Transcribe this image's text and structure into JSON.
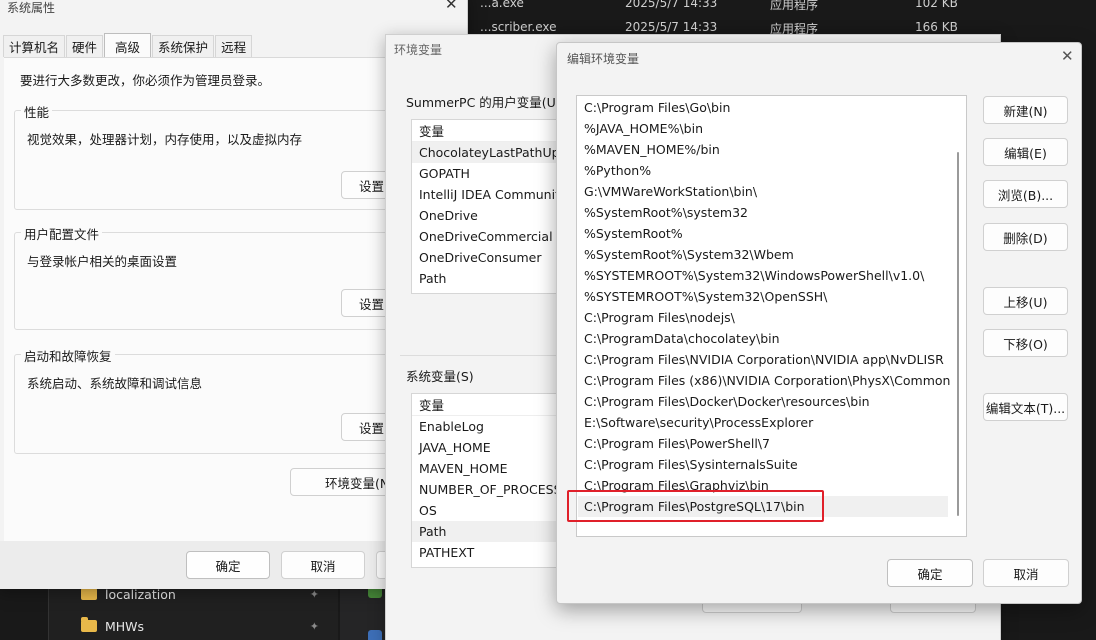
{
  "explorer": {
    "rows": [
      {
        "name": "...a.exe",
        "date": "2025/5/7 14:33",
        "type": "应用程序",
        "size": "102 KB"
      },
      {
        "name": "...scriber.exe",
        "date": "2025/5/7 14:33",
        "type": "应用程序",
        "size": "166 KB"
      }
    ],
    "sidebar": [
      {
        "label": "localization"
      },
      {
        "label": "MHWs"
      }
    ]
  },
  "system_properties": {
    "title": "系统属性",
    "tabs": [
      "计算机名",
      "硬件",
      "高级",
      "系统保护",
      "远程"
    ],
    "active_tab": "高级",
    "admin_note": "要进行大多数更改，你必须作为管理员登录。",
    "groups": [
      {
        "title": "性能",
        "desc": "视觉效果，处理器计划，内存使用，以及虚拟内存",
        "button": "设置("
      },
      {
        "title": "用户配置文件",
        "desc": "与登录帐户相关的桌面设置",
        "button": "设置("
      },
      {
        "title": "启动和故障恢复",
        "desc": "系统启动、系统故障和调试信息",
        "button": "设置("
      }
    ],
    "env_button": "环境变量(N",
    "ok": "确定",
    "cancel": "取消"
  },
  "environment_variables": {
    "title": "环境变量",
    "user_label": "SummerPC 的用户变量(U)",
    "user_header": "变量",
    "user_vars": [
      "ChocolateyLastPathUpda",
      "GOPATH",
      "IntelliJ IDEA Community",
      "OneDrive",
      "OneDriveCommercial",
      "OneDriveConsumer",
      "Path"
    ],
    "system_label": "系统变量(S)",
    "system_header": "变量",
    "system_vars": [
      "EnableLog",
      "JAVA_HOME",
      "MAVEN_HOME",
      "NUMBER_OF_PROCESSO",
      "OS",
      "Path",
      "PATHEXT"
    ],
    "selected_system": "Path"
  },
  "edit_env": {
    "title": "编辑环境变量",
    "paths": [
      "C:\\Program Files\\Go\\bin",
      "%JAVA_HOME%\\bin",
      "%MAVEN_HOME%/bin",
      "%Python%",
      "G:\\VMWareWorkStation\\bin\\",
      "%SystemRoot%\\system32",
      "%SystemRoot%",
      "%SystemRoot%\\System32\\Wbem",
      "%SYSTEMROOT%\\System32\\WindowsPowerShell\\v1.0\\",
      "%SYSTEMROOT%\\System32\\OpenSSH\\",
      "C:\\Program Files\\nodejs\\",
      "C:\\ProgramData\\chocolatey\\bin",
      "C:\\Program Files\\NVIDIA Corporation\\NVIDIA app\\NvDLISR",
      "C:\\Program Files (x86)\\NVIDIA Corporation\\PhysX\\Common",
      "C:\\Program Files\\Docker\\Docker\\resources\\bin",
      "E:\\Software\\security\\ProcessExplorer",
      "C:\\Program Files\\PowerShell\\7",
      "C:\\Program Files\\SysinternalsSuite",
      "C:\\Program Files\\Graphviz\\bin",
      "C:\\Program Files\\PostgreSQL\\17\\bin"
    ],
    "selected_index": 19,
    "buttons": {
      "new": "新建(N)",
      "edit": "编辑(E)",
      "browse": "浏览(B)...",
      "delete": "删除(D)",
      "move_up": "上移(U)",
      "move_down": "下移(O)",
      "edit_text": "编辑文本(T)..."
    },
    "ok": "确定",
    "cancel": "取消",
    "close_glyph": "✕"
  },
  "highlight_color": "#e0202a"
}
